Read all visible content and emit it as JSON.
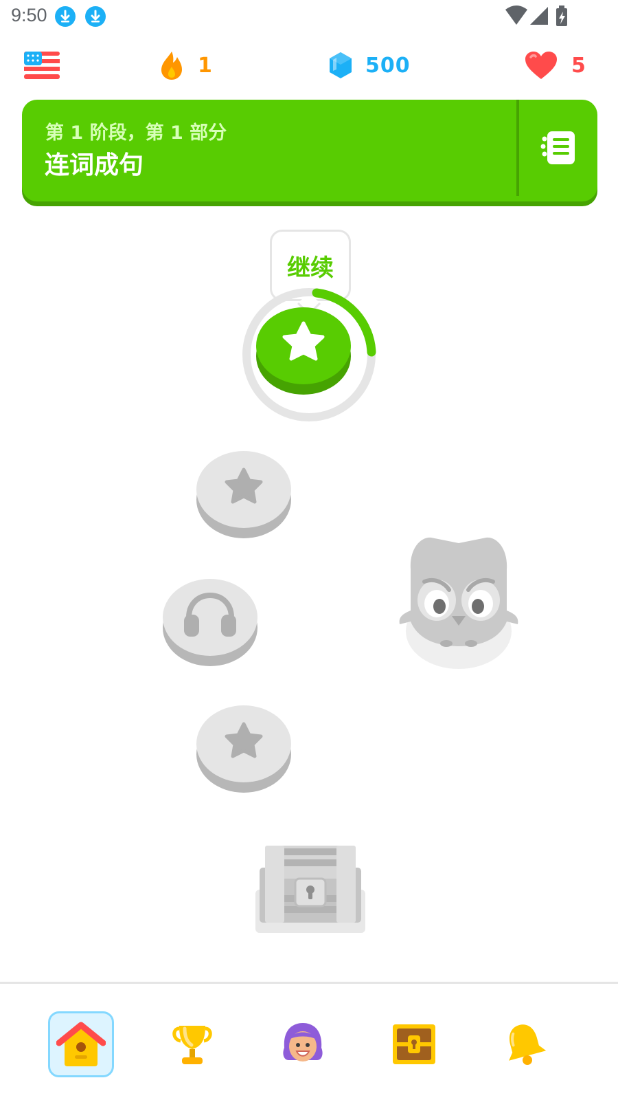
{
  "status_bar": {
    "time": "9:50",
    "icons": [
      "download-icon",
      "download-icon",
      "wifi-icon",
      "signal-icon",
      "battery-charging-icon"
    ]
  },
  "top_bar": {
    "course_flag": "us-flag-icon",
    "streak": "1",
    "gems": "500",
    "hearts": "5",
    "colors": {
      "streak": "#ff9600",
      "gems": "#1cb0f6",
      "hearts": "#ff4b4b"
    }
  },
  "unit": {
    "subtitle": "第 1 阶段，第 1 部分",
    "title": "连词成句",
    "guidebook_icon": "guidebook-icon",
    "color": "#58cc02"
  },
  "path": {
    "tooltip": "继续",
    "nodes": [
      {
        "type": "star",
        "state": "active",
        "icon": "star-icon",
        "progress": 0.3
      },
      {
        "type": "star",
        "state": "locked",
        "icon": "star-icon"
      },
      {
        "type": "listening",
        "state": "locked",
        "icon": "headphones-icon"
      },
      {
        "type": "star",
        "state": "locked",
        "icon": "star-icon"
      },
      {
        "type": "chest",
        "state": "locked",
        "icon": "treasure-chest-icon"
      }
    ],
    "mascot": "owl-mascot"
  },
  "bottom_nav": {
    "items": [
      {
        "name": "home",
        "icon": "home-icon",
        "active": true
      },
      {
        "name": "leaderboard",
        "icon": "trophy-icon",
        "active": false
      },
      {
        "name": "profile",
        "icon": "profile-avatar-icon",
        "active": false
      },
      {
        "name": "shop",
        "icon": "treasure-chest-icon",
        "active": false
      },
      {
        "name": "notifications",
        "icon": "bell-icon",
        "active": false
      }
    ]
  }
}
